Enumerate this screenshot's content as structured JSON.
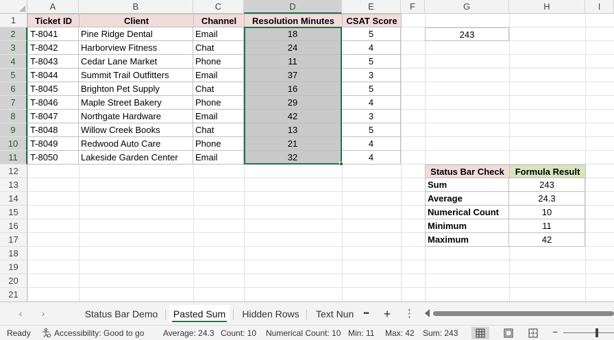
{
  "columns": [
    "A",
    "B",
    "C",
    "D",
    "E",
    "F",
    "G",
    "H",
    "I"
  ],
  "selected_column": "D",
  "rows": [
    "1",
    "2",
    "3",
    "4",
    "5",
    "6",
    "7",
    "8",
    "9",
    "10",
    "11",
    "12",
    "13",
    "14",
    "15",
    "16",
    "17",
    "18",
    "19",
    "20",
    "21"
  ],
  "table": {
    "headers": [
      "Ticket ID",
      "Client",
      "Channel",
      "Resolution Minutes",
      "CSAT Score"
    ],
    "rows": [
      [
        "T-8041",
        "Pine Ridge Dental",
        "Email",
        "18",
        "5"
      ],
      [
        "T-8042",
        "Harborview Fitness",
        "Chat",
        "24",
        "4"
      ],
      [
        "T-8043",
        "Cedar Lane Market",
        "Phone",
        "11",
        "5"
      ],
      [
        "T-8044",
        "Summit Trail Outfitters",
        "Email",
        "37",
        "3"
      ],
      [
        "T-8045",
        "Brighton Pet Supply",
        "Chat",
        "16",
        "5"
      ],
      [
        "T-8046",
        "Maple Street Bakery",
        "Phone",
        "29",
        "4"
      ],
      [
        "T-8047",
        "Northgate Hardware",
        "Email",
        "42",
        "3"
      ],
      [
        "T-8048",
        "Willow Creek Books",
        "Chat",
        "13",
        "5"
      ],
      [
        "T-8049",
        "Redwood Auto Care",
        "Phone",
        "21",
        "4"
      ],
      [
        "T-8050",
        "Lakeside Garden Center",
        "Email",
        "32",
        "4"
      ]
    ]
  },
  "g2_value": "243",
  "check_table": {
    "headers": [
      "Status Bar Check",
      "Formula Result"
    ],
    "rows": [
      [
        "Sum",
        "243"
      ],
      [
        "Average",
        "24.3"
      ],
      [
        "Numerical Count",
        "10"
      ],
      [
        "Minimum",
        "11"
      ],
      [
        "Maximum",
        "42"
      ]
    ]
  },
  "sheet_tabs": {
    "prev_icon": "‹",
    "next_icon": "›",
    "tabs": [
      "Status Bar Demo",
      "Pasted Sum",
      "Hidden Rows",
      "Text Nun"
    ],
    "active_index": 1,
    "more_icon": "•••",
    "add_icon": "+",
    "options_icon": "⋮"
  },
  "status": {
    "ready": "Ready",
    "accessibility": "Accessibility: Good to go",
    "average": "Average: 24.3",
    "count": "Count: 10",
    "numerical_count": "Numerical Count: 10",
    "min": "Min: 11",
    "max": "Max: 42",
    "sum": "Sum: 243",
    "zoom_minus": "−"
  },
  "colors": {
    "accent": "#217346",
    "header_fill": "#f2dcdb",
    "selection_fill": "#c9c9c9",
    "result_header_fill": "#d8e4bc"
  }
}
